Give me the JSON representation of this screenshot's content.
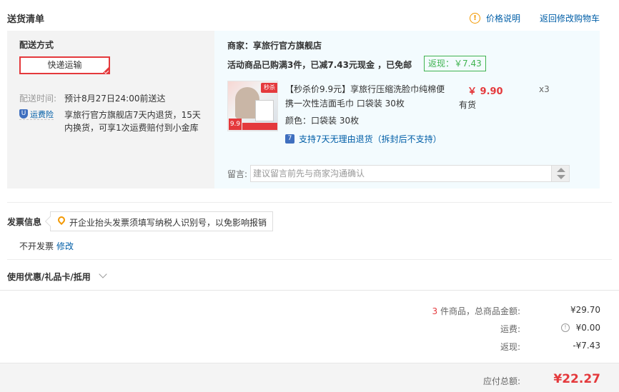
{
  "header": {
    "title": "送货清单",
    "price_note": "价格说明",
    "back_to_cart": "返回修改购物车"
  },
  "shipping": {
    "label": "配送方式",
    "method": "快递运输",
    "time_label": "配送时间:",
    "time_value": "预计8月27日24:00前送达",
    "insurance_badge": "运费险",
    "insurance_desc": "享旅行官方旗舰店7天内退货，15天内换货，可享1次运费赔付到小金库"
  },
  "seller": {
    "name": "商家：享旅行官方旗舰店",
    "promo": "活动商品已购满3件，已减7.43元现金 ，已免邮",
    "rebate": "返现：￥7.43"
  },
  "product": {
    "name": "【秒杀价9.9元】享旅行压缩洗脸巾纯棉便携一次性洁面毛巾 口袋装 30枚",
    "price": "￥ 9.90",
    "stock": "有货",
    "qty": "x3",
    "color": "颜色：口袋装 30枚",
    "return_policy": "支持7天无理由退货（拆封后不支持）",
    "thumb_badge": "9.9",
    "thumb_tag": "秒杀"
  },
  "message": {
    "label": "留言:",
    "placeholder": "建议留言前先与商家沟通确认"
  },
  "invoice": {
    "title": "发票信息",
    "tip": "开企业抬头发票须填写纳税人识别号，以免影响报销",
    "status": "不开发票",
    "edit": "修改"
  },
  "coupon": {
    "label": "使用优惠/礼品卡/抵用"
  },
  "summary": {
    "count": "3",
    "count_suffix": " 件商品，总商品金额:",
    "goods_total": "¥29.70",
    "freight_label": "运费:",
    "freight": "¥0.00",
    "rebate_label": "返现:",
    "rebate": "-¥7.43",
    "payable_label": "应付总额:",
    "payable": "¥22.27"
  },
  "colors": {
    "accent_red": "#e4393c",
    "link_blue": "#005ea7",
    "rebate_green": "#3fb34f",
    "warn_orange": "#f39800"
  }
}
